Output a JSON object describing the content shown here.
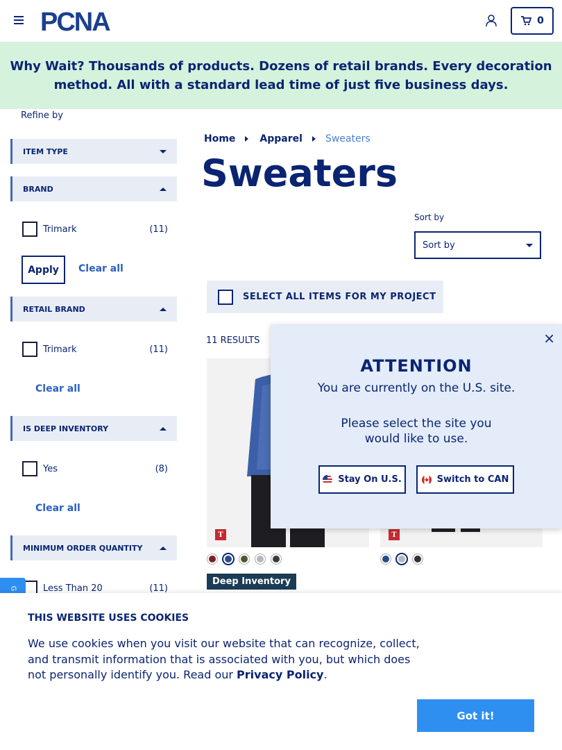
{
  "header": {
    "logo_text": "PCNA",
    "cart_count": "0"
  },
  "banner": {
    "lead": "Why Wait?",
    "text": " Thousands of products. Dozens of retail brands. Every decoration method. All with a standard lead time of just five business days."
  },
  "sidebar": {
    "refine_label": "Refine by",
    "facets": [
      {
        "title": "ITEM TYPE"
      },
      {
        "title": "BRAND",
        "options": [
          {
            "label": "Trimark",
            "count": "(11)"
          }
        ],
        "apply_label": "Apply",
        "clear_label": "Clear all"
      },
      {
        "title": "RETAIL BRAND",
        "options": [
          {
            "label": "Trimark",
            "count": "(11)"
          }
        ],
        "clear_label": "Clear all"
      },
      {
        "title": "IS DEEP INVENTORY",
        "options": [
          {
            "label": "Yes",
            "count": "(8)"
          }
        ],
        "clear_label": "Clear all"
      },
      {
        "title": "MINIMUM ORDER QUANTITY",
        "options": [
          {
            "label": "Less Than 20",
            "count": "(11)"
          }
        ]
      }
    ]
  },
  "breadcrumb": {
    "items": [
      "Home",
      "Apparel",
      "Sweaters"
    ]
  },
  "page_title": "Sweaters",
  "sort": {
    "label": "Sort by",
    "selected": "Sort by"
  },
  "select_all_label": "SELECT ALL ITEMS FOR MY PROJECT",
  "results_label": "11 RESULTS",
  "products": [
    {
      "badge": "T",
      "swatches": [
        "#7a1f2b",
        "#2a4f8f",
        "#4a5a2a",
        "#b4b8be",
        "#3a3a3a"
      ],
      "selected_swatch": 1,
      "tag": "Deep Inventory"
    },
    {
      "badge": "T",
      "swatches": [
        "#234f86",
        "#b4b8be",
        "#333333"
      ],
      "selected_swatch": 1
    }
  ],
  "modal": {
    "title": "ATTENTION",
    "line1": "You are currently on the U.S. site.",
    "line2": "Please select the site you would like to use.",
    "stay_label": "Stay On U.S.",
    "switch_label": "Switch to CAN",
    "close_glyph": "×"
  },
  "side_tab_label": "G",
  "cookie": {
    "title": "THIS WEBSITE USES COOKIES",
    "text": "We use cookies when you visit our website that can recognize, collect, and transmit information that is associated with you, but which does not personally identify you. Read our ",
    "link": "Privacy Policy",
    "period": ".",
    "button": "Got it!"
  },
  "colors": {
    "navy": "#0a2472",
    "banner_bg": "#d5f2dd",
    "accent_blue": "#2e8ff0",
    "facet_bg": "#e8edf5"
  }
}
